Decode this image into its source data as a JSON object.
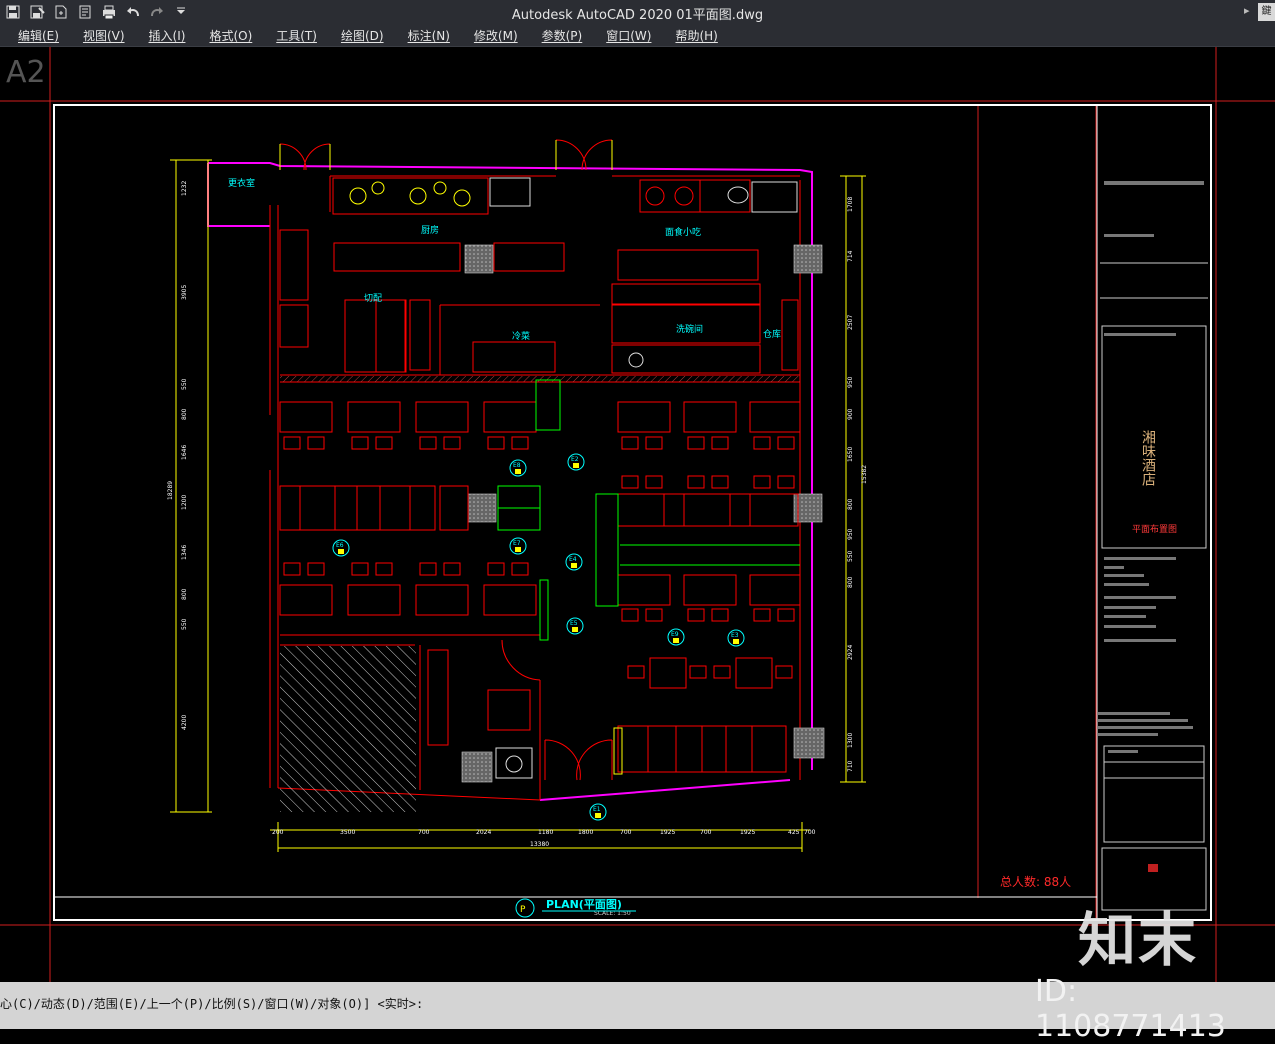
{
  "window": {
    "title": "Autodesk AutoCAD 2020    01平面图.dwg",
    "more_glyph": "▸",
    "search_glyph": "鍵"
  },
  "quick_access": [
    {
      "name": "save-icon"
    },
    {
      "name": "save-as-icon"
    },
    {
      "name": "open-icon"
    },
    {
      "name": "publish-icon"
    },
    {
      "name": "plot-icon"
    },
    {
      "name": "undo-icon"
    },
    {
      "name": "redo-icon"
    },
    {
      "name": "customize-dropdown-icon"
    }
  ],
  "menu": [
    "编辑(E)",
    "视图(V)",
    "插入(I)",
    "格式(O)",
    "工具(T)",
    "绘图(D)",
    "标注(N)",
    "修改(M)",
    "参数(P)",
    "窗口(W)",
    "帮助(H)"
  ],
  "drawing": {
    "sheet_label": "A2",
    "plan_title": "PLAN(平面图)",
    "plan_scale": "SCALE: 1:50",
    "plan_marker": "P",
    "total_people": "总人数: 88人",
    "project_name": "湘味酒店",
    "sheet_name": "平面布置图",
    "room_labels": {
      "changing": "更衣室",
      "kitchen": "厨房",
      "noodle": "面食小吃",
      "prep": "切配",
      "cold": "冷菜",
      "wash": "洗碗间",
      "storage": "仓库"
    },
    "elevation_markers": [
      "E1",
      "E2",
      "E3",
      "E4",
      "E5",
      "E6",
      "E7",
      "E8",
      "E9"
    ],
    "dims_bottom": [
      "200",
      "3500",
      "700",
      "2024",
      "1180",
      "1800",
      "700",
      "1925",
      "700",
      "1925",
      "425",
      "700"
    ],
    "dims_total": "13380",
    "dims_left": [
      "1232",
      "3905",
      "550",
      "800",
      "1646",
      "1200",
      "1346",
      "800",
      "550",
      "4200"
    ],
    "dims_left_total": "18289",
    "dims_right": [
      "1708",
      "714",
      "2507",
      "950",
      "900",
      "1650",
      "800",
      "950",
      "550",
      "800",
      "2924",
      "1300",
      "710"
    ],
    "dims_right_total": "15382",
    "colors": {
      "wall": "#ff0000",
      "dim": "#ffff00",
      "boundary": "#ff00ff",
      "text": "#00ffff",
      "green": "#00ff00",
      "frame": "#ffffff"
    }
  },
  "command": {
    "prompt": "心(C)/动态(D)/范围(E)/上一个(P)/比例(S)/窗口(W)/对象(O)] <实时>:"
  },
  "watermark": {
    "logo": "知末",
    "id": "ID: 1108771413"
  }
}
